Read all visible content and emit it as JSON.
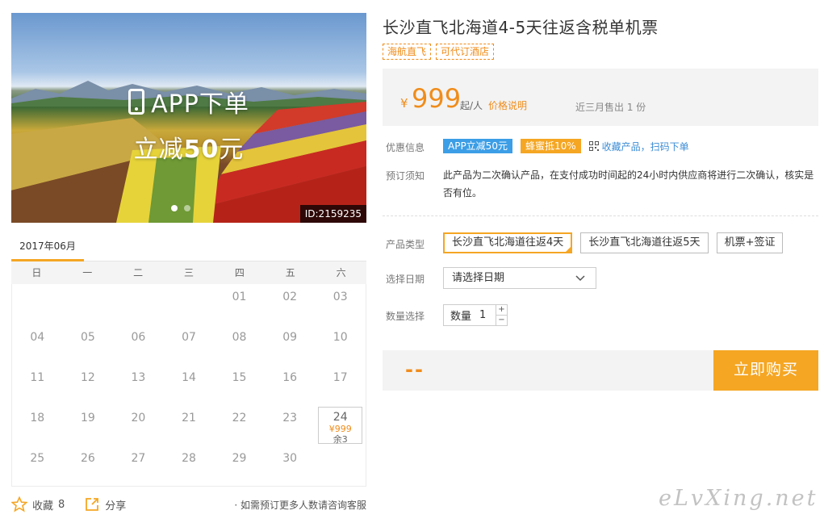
{
  "hero": {
    "app_text": "APP下单",
    "discount_prefix": "立减",
    "discount_amount": "50",
    "discount_suffix": "元",
    "image_id": "ID:2159235",
    "slide_count": 2,
    "active_slide": 1
  },
  "calendar": {
    "month": "2017年06月",
    "weekdays": [
      "日",
      "一",
      "二",
      "三",
      "四",
      "五",
      "六"
    ],
    "leading_blanks": 4,
    "days": [
      "01",
      "02",
      "03",
      "04",
      "05",
      "06",
      "07",
      "08",
      "09",
      "10",
      "11",
      "12",
      "13",
      "14",
      "15",
      "16",
      "17",
      "18",
      "19",
      "20",
      "21",
      "22",
      "23",
      "24",
      "25",
      "26",
      "27",
      "28",
      "29",
      "30"
    ],
    "available": {
      "day": "24",
      "price": "¥999",
      "remain": "余3"
    }
  },
  "footer": {
    "favorite_label": "收藏",
    "favorite_count": "8",
    "share_label": "分享",
    "consult_text": "· 如需预订更多人数请咨询客服"
  },
  "product": {
    "title": "长沙直飞北海道4-5天往返含税单机票",
    "tags": [
      "海航直飞",
      "可代订酒店"
    ]
  },
  "price": {
    "currency": "¥",
    "amount": "999",
    "unit": "起/人",
    "explain_link": "价格说明",
    "sold": "近三月售出 1 份"
  },
  "promo": {
    "label": "优惠信息",
    "badge_app": "APP立减50元",
    "badge_honey": "蜂蜜抵10%",
    "qr_link": "收藏产品，扫码下单"
  },
  "notice": {
    "label": "预订须知",
    "text": "此产品为二次确认产品，在支付成功时间起的24小时内供应商将进行二次确认，核实是否有位。"
  },
  "options": {
    "type_label": "产品类型",
    "types": [
      "长沙直飞北海道往返4天",
      "长沙直飞北海道往返5天",
      "机票+签证"
    ],
    "selected_type": 0,
    "date_label": "选择日期",
    "date_placeholder": "请选择日期",
    "qty_label": "数量选择",
    "qty_field_label": "数量",
    "qty_value": "1",
    "qty_plus": "+",
    "qty_minus": "−"
  },
  "buy": {
    "total": "--",
    "button": "立即购买"
  },
  "watermark": "eLvXing.net",
  "colors": {
    "accent": "#f5a623",
    "price": "#f08c1a",
    "link_blue": "#3c8dd6",
    "badge_blue": "#3c9ee6"
  }
}
